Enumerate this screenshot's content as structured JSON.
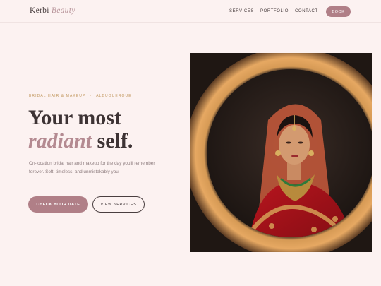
{
  "header": {
    "logo_main": "Kerbi",
    "logo_accent": "Beauty",
    "nav": {
      "services": "SERVICES",
      "portfolio": "PORTFOLIO",
      "contact": "CONTACT",
      "book": "BOOK"
    }
  },
  "hero": {
    "eyebrow_left": "BRIDAL HAIR & MAKEUP",
    "eyebrow_sep": "·",
    "eyebrow_right": "ALBUQUERQUE",
    "headline_line1": "Your most",
    "headline_em": "radiant",
    "headline_rest": " self.",
    "subtext": "On-location bridal hair and makeup for the day you'll remember forever. Soft, timeless, and unmistakably you.",
    "cta_primary": "CHECK YOUR DATE",
    "cta_secondary": "VIEW SERVICES"
  },
  "colors": {
    "background": "#fcf2f1",
    "accent": "#b07f87",
    "eyebrow": "#c1975d"
  },
  "image": {
    "subject": "bride-in-ring-light-photo"
  }
}
